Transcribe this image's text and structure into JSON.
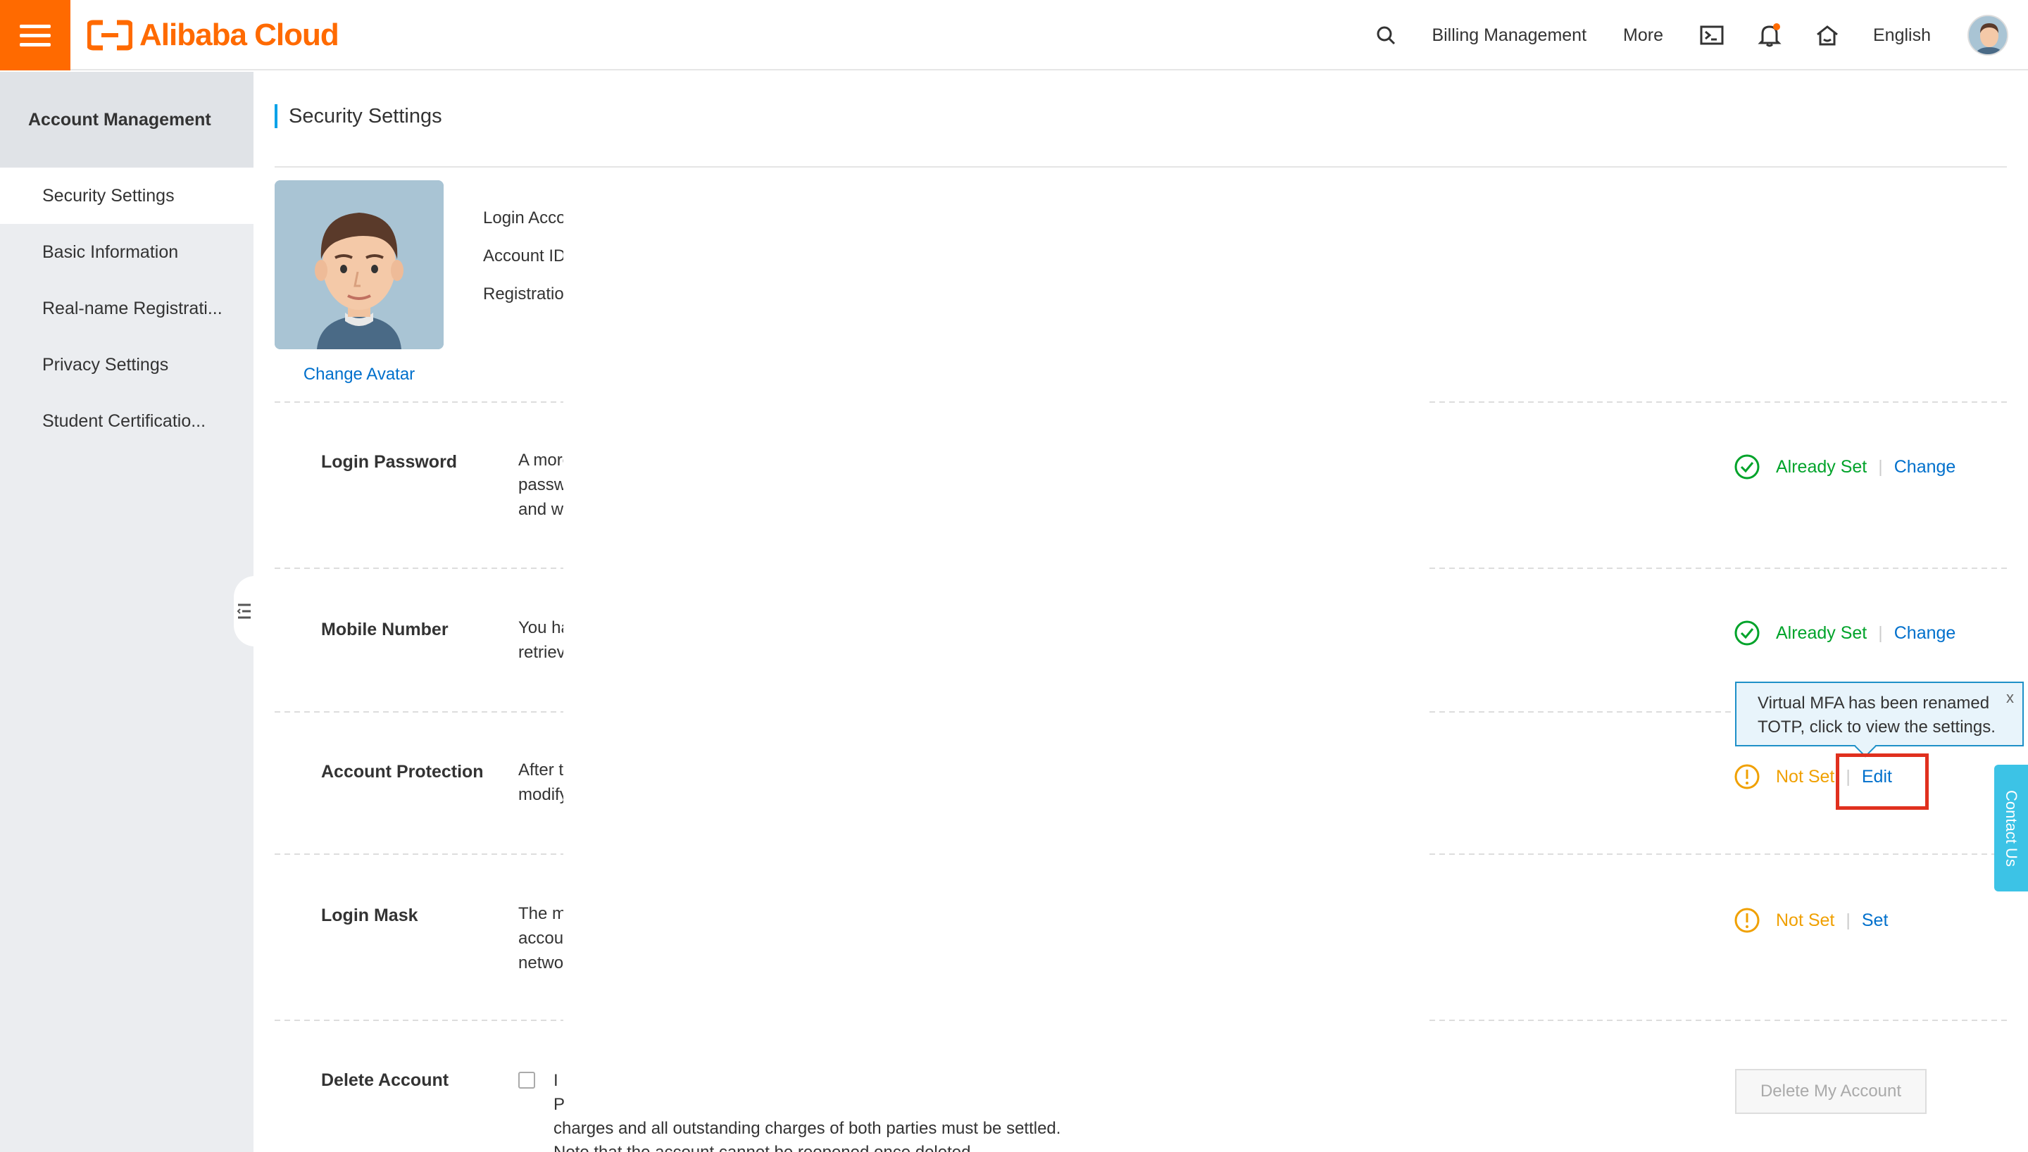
{
  "header": {
    "brand": "Alibaba Cloud",
    "billing": "Billing Management",
    "more": "More",
    "language": "English"
  },
  "sidebar": {
    "title": "Account Management",
    "items": [
      {
        "label": "Security Settings"
      },
      {
        "label": "Basic Information"
      },
      {
        "label": "Real-name Registrati..."
      },
      {
        "label": "Privacy Settings"
      },
      {
        "label": "Student Certificatio..."
      }
    ]
  },
  "main": {
    "title": "Security Settings",
    "change_avatar": "Change Avatar",
    "info": [
      "Login Account",
      "Account ID",
      "Registration"
    ],
    "rows": {
      "password": {
        "title": "Login Password",
        "desc": [
          "A more",
          "password",
          "and w"
        ],
        "status": "Already Set",
        "action": "Change"
      },
      "mobile": {
        "title": "Mobile Number",
        "desc": [
          "You have",
          "retrieve"
        ],
        "status": "Already Set",
        "action": "Change"
      },
      "protection": {
        "title": "Account Protection",
        "desc": [
          "After t",
          "modify"
        ],
        "status": "Not Set",
        "action": "Edit"
      },
      "mask": {
        "title": "Login Mask",
        "desc": [
          "The m",
          "account",
          "network"
        ],
        "status": "Not Set",
        "action": "Set"
      },
      "delete": {
        "title": "Delete Account",
        "text_lines": [
          "I",
          "P",
          "charges and all outstanding charges of both parties must be settled.",
          "Note that the account cannot be reopened once deleted."
        ],
        "button": "Delete My Account"
      }
    },
    "tooltip": {
      "text": "Virtual MFA has been renamed TOTP, click to view the settings.",
      "close": "x"
    }
  },
  "contact": "Contact Us",
  "colors": {
    "brand": "#ff6a00",
    "link": "#0070cc",
    "ok": "#00a32a",
    "warn": "#f0a000",
    "highlight": "#e0301e"
  }
}
